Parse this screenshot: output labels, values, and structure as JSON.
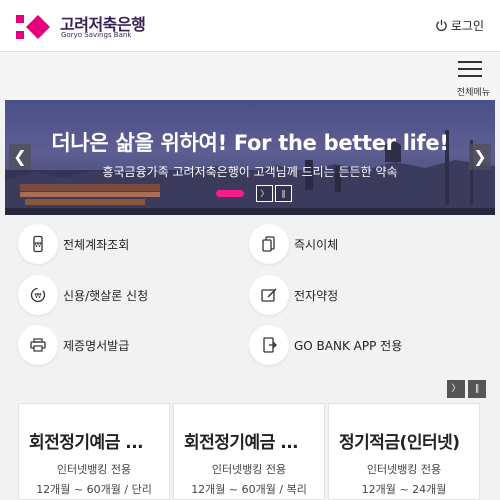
{
  "header": {
    "logo_ko": "고려저축은행",
    "logo_en": "Goryo Savings Bank",
    "login_label": "로그인",
    "brand_color": "#e6007e"
  },
  "menu": {
    "label": "전체메뉴"
  },
  "banner": {
    "title": "더나은 삶을 위하여! For the better life!",
    "subtitle": "흥국금융가족 고려저축은행이 고객님께 드리는 든든한 약속",
    "prev": "❮",
    "next": "❯",
    "next_btn": "〉",
    "pause_btn": "∥",
    "indicator_color": "#ff1a8c"
  },
  "quick_menu": [
    {
      "label": "전체계좌조회",
      "icon": "phone-icon"
    },
    {
      "label": "즉시이체",
      "icon": "transfer-icon"
    },
    {
      "label": "신용/햇살론 신청",
      "icon": "loan-icon"
    },
    {
      "label": "전자약정",
      "icon": "contract-icon"
    },
    {
      "label": "제증명서발급",
      "icon": "printer-icon"
    },
    {
      "label": "GO BANK APP 전용",
      "icon": "app-icon"
    }
  ],
  "pager": {
    "next": "〉",
    "pause": "∥"
  },
  "products": [
    {
      "title": "회전정기예금 ...",
      "line1": "인터넷뱅킹 전용",
      "line2": "12개월 ~ 60개월 / 단리"
    },
    {
      "title": "회전정기예금 ...",
      "line1": "인터넷뱅킹 전용",
      "line2": "12개월 ~ 60개월 / 복리"
    },
    {
      "title": "정기적금(인터넷)",
      "line1": "인터넷뱅킹 전용",
      "line2": "12개월 ~ 24개월"
    }
  ]
}
